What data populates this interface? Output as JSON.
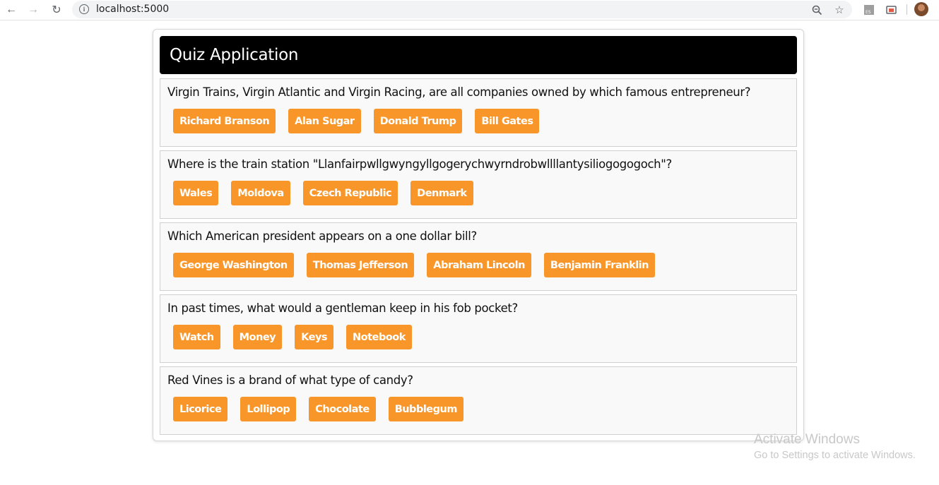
{
  "browser": {
    "url": "localhost:5000",
    "icons": {
      "back": "arrow-left-icon",
      "forward": "arrow-right-icon",
      "reload": "reload-icon",
      "info": "info-icon",
      "zoom": "zoom-icon",
      "bookmark": "star-icon",
      "extension1": "es-extension-icon",
      "extension2": "cast-extension-icon",
      "profile": "avatar"
    }
  },
  "app": {
    "title": "Quiz Application"
  },
  "questions": [
    {
      "text": "Virgin Trains, Virgin Atlantic and Virgin Racing, are all companies owned by which famous entrepreneur?",
      "answers": [
        "Richard Branson",
        "Alan Sugar",
        "Donald Trump",
        "Bill Gates"
      ]
    },
    {
      "text": "Where is the train station \"Llanfairpwllgwyngyllgogerychwyrndrobwllllantysiliogogogoch\"?",
      "answers": [
        "Wales",
        "Moldova",
        "Czech Republic",
        "Denmark"
      ]
    },
    {
      "text": "Which American president appears on a one dollar bill?",
      "answers": [
        "George Washington",
        "Thomas Jefferson",
        "Abraham Lincoln",
        "Benjamin Franklin"
      ]
    },
    {
      "text": "In past times, what would a gentleman keep in his fob pocket?",
      "answers": [
        "Watch",
        "Money",
        "Keys",
        "Notebook"
      ]
    },
    {
      "text": "Red Vines is a brand of what type of candy?",
      "answers": [
        "Licorice",
        "Lollipop",
        "Chocolate",
        "Bubblegum"
      ]
    }
  ],
  "watermark": {
    "line1": "Activate Windows",
    "line2": "Go to Settings to activate Windows."
  },
  "colors": {
    "header_bg": "#000000",
    "answer_bg": "#f8962a",
    "question_bg": "#f9f9f9"
  }
}
